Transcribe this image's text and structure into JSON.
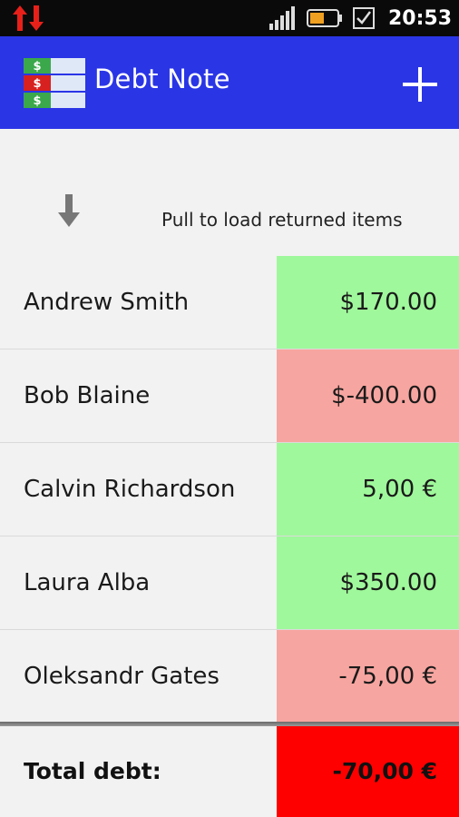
{
  "status_bar": {
    "time": "20:53",
    "icons": [
      "data-transfer-icon",
      "signal-icon",
      "battery-icon",
      "notification-checkbox-icon"
    ]
  },
  "action_bar": {
    "title": "Debt Note",
    "logo_icon": "dollar-bills-icon",
    "add_icon": "plus-icon",
    "color": "#2a35e6"
  },
  "pull_to_refresh": {
    "text": "Pull to load returned items",
    "icon": "arrow-down-icon"
  },
  "debts": [
    {
      "name": "Andrew Smith",
      "amount": "$170.00",
      "status": "positive"
    },
    {
      "name": "Bob Blaine",
      "amount": "$-400.00",
      "status": "negative"
    },
    {
      "name": "Calvin Richardson",
      "amount": "5,00 €",
      "status": "positive"
    },
    {
      "name": "Laura Alba",
      "amount": "$350.00",
      "status": "positive"
    },
    {
      "name": "Oleksandr Gates",
      "amount": "-75,00 €",
      "status": "negative"
    }
  ],
  "footer": {
    "label": "Total debt:",
    "amount": "-70,00 €"
  },
  "colors": {
    "positive": "#9ff89b",
    "negative": "#f7a5a0",
    "total_negative": "#ff0000"
  }
}
